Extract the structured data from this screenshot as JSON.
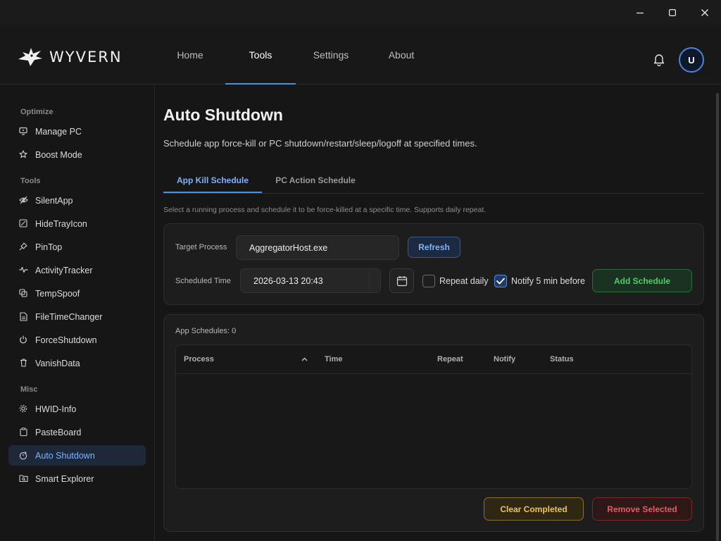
{
  "window": {
    "minimize_icon": "minimize-icon",
    "maximize_icon": "maximize-icon",
    "close_icon": "close-icon"
  },
  "brand": {
    "name": "WYVERN",
    "logo_icon": "wyvern-dragon-logo"
  },
  "nav": {
    "items": [
      {
        "label": "Home",
        "active": false
      },
      {
        "label": "Tools",
        "active": true
      },
      {
        "label": "Settings",
        "active": false
      },
      {
        "label": "About",
        "active": false
      }
    ],
    "bell_icon": "bell-icon",
    "avatar_initial": "U"
  },
  "sidebar": {
    "sections": [
      {
        "title": "Optimize",
        "items": [
          {
            "label": "Manage PC",
            "icon": "monitor-icon"
          },
          {
            "label": "Boost Mode",
            "icon": "star-icon"
          }
        ]
      },
      {
        "title": "Tools",
        "items": [
          {
            "label": "SilentApp",
            "icon": "eye-off-icon"
          },
          {
            "label": "HideTrayIcon",
            "icon": "hide-tray-icon"
          },
          {
            "label": "PinTop",
            "icon": "pin-icon"
          },
          {
            "label": "ActivityTracker",
            "icon": "activity-icon"
          },
          {
            "label": "TempSpoof",
            "icon": "temp-spoof-icon"
          },
          {
            "label": "FileTimeChanger",
            "icon": "file-icon"
          },
          {
            "label": "ForceShutdown",
            "icon": "power-icon"
          },
          {
            "label": "VanishData",
            "icon": "trash-icon"
          }
        ]
      },
      {
        "title": "Misc",
        "items": [
          {
            "label": "HWID-Info",
            "icon": "chip-icon"
          },
          {
            "label": "PasteBoard",
            "icon": "clipboard-icon"
          },
          {
            "label": "Auto Shutdown",
            "icon": "timer-icon",
            "active": true
          },
          {
            "label": "Smart Explorer",
            "icon": "folder-search-icon"
          }
        ]
      }
    ]
  },
  "main": {
    "title": "Auto Shutdown",
    "description": "Schedule app force-kill or PC shutdown/restart/sleep/logoff at specified times.",
    "tabs": [
      {
        "label": "App Kill Schedule",
        "active": true
      },
      {
        "label": "PC Action Schedule",
        "active": false
      }
    ],
    "tab_description": "Select a running process and schedule it to be force-killed at a specific time. Supports daily repeat.",
    "form": {
      "target_process_label": "Target Process",
      "target_process_value": "AggregatorHost.exe",
      "refresh_label": "Refresh",
      "scheduled_time_label": "Scheduled Time",
      "scheduled_time_value": "2026-03-13  20:43",
      "calendar_icon": "calendar-icon",
      "repeat_daily_label": "Repeat daily",
      "repeat_daily_checked": false,
      "notify_label": "Notify 5 min before",
      "notify_checked": true,
      "add_label": "Add Schedule"
    },
    "schedules": {
      "count_label": "App Schedules: 0",
      "columns": [
        "Process",
        "Time",
        "Repeat",
        "Notify",
        "Status"
      ],
      "sort_icon": "sort-up-icon",
      "rows": [],
      "clear_label": "Clear Completed",
      "remove_label": "Remove Selected"
    }
  },
  "colors": {
    "accent": "#4a8fe7",
    "success": "#4cd06e",
    "warning": "#f2c24a",
    "danger": "#ef5a5a"
  }
}
